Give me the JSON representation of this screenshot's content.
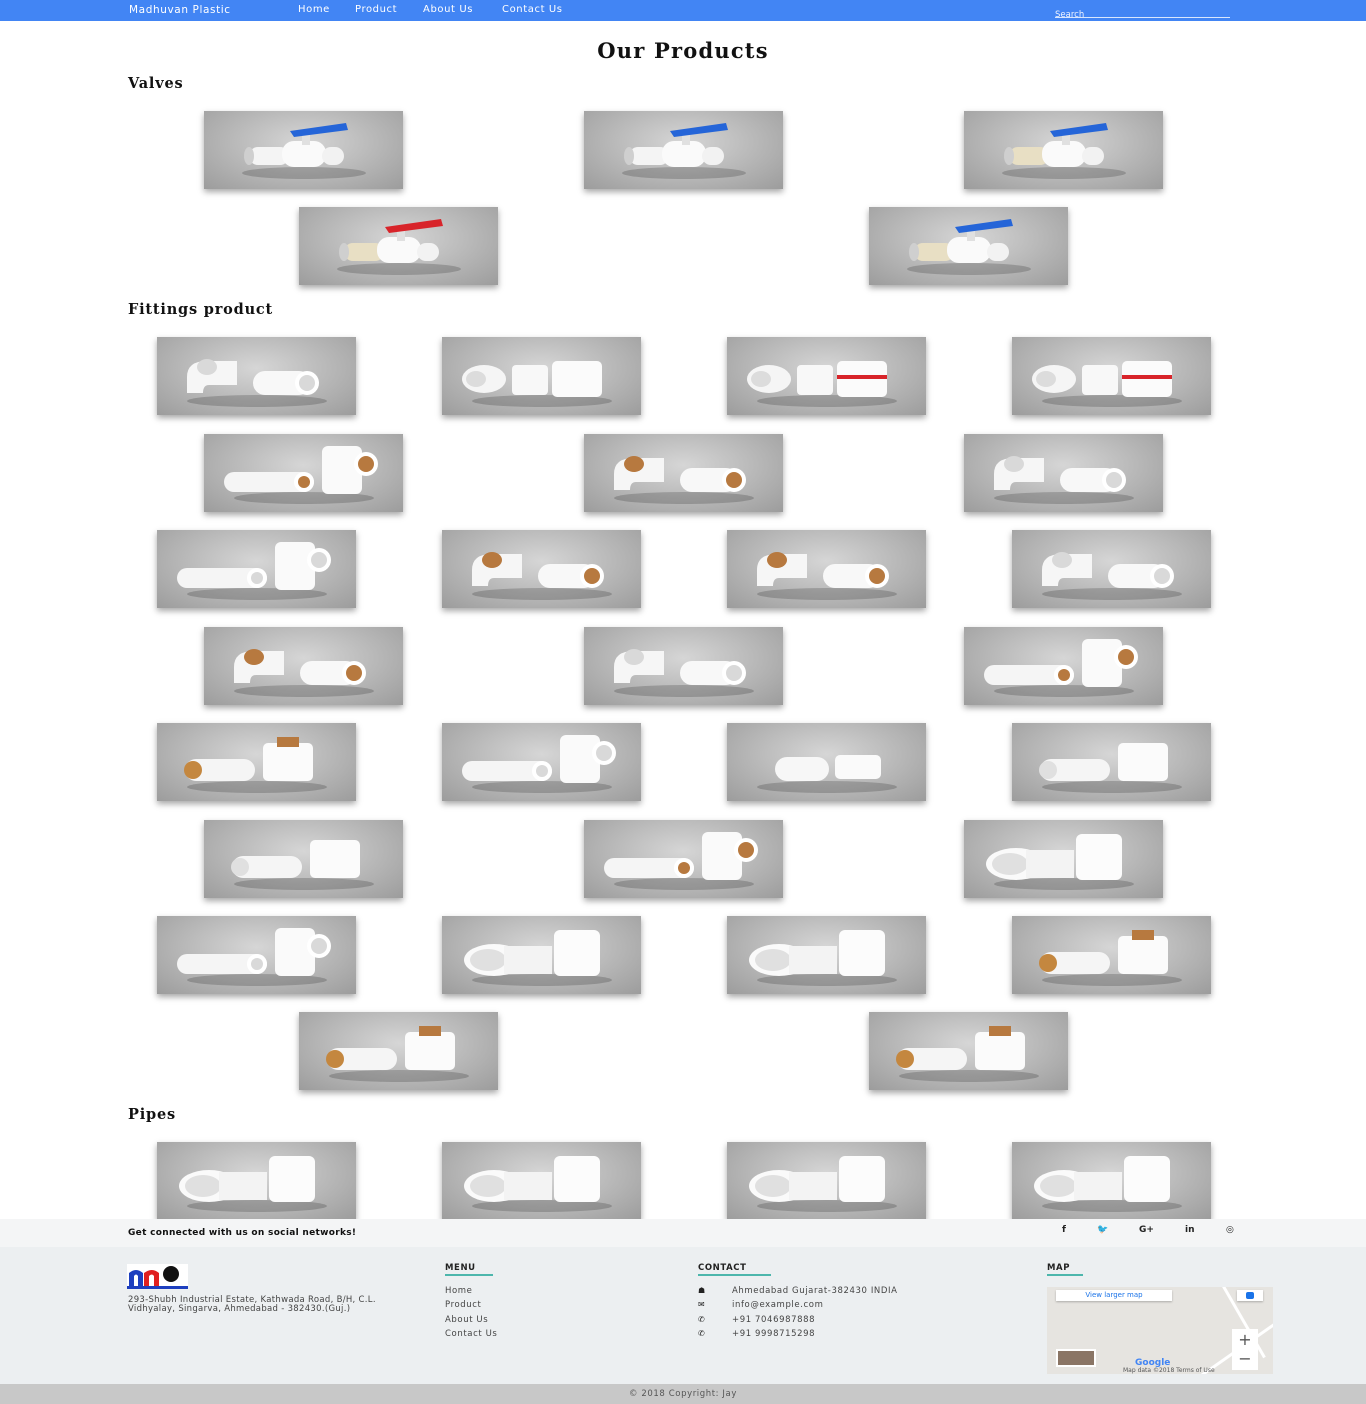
{
  "navbar": {
    "brand": "Madhuvan Plastic",
    "links": [
      "Home",
      "Product",
      "About Us",
      "Contact Us"
    ],
    "search_placeholder": "Search",
    "background_color": "#4285f4"
  },
  "page_title": "Our Products",
  "sections": [
    {
      "title": "Valves",
      "products": [
        {
          "icon": "blue-handle-ball-valve"
        },
        {
          "icon": "blue-handle-ball-valve"
        },
        {
          "icon": "blue-handle-cpvc-ball-valve"
        },
        {
          "icon": "red-handle-cpvc-ball-valve"
        },
        {
          "icon": "blue-handle-cpvc-ball-valve"
        }
      ]
    },
    {
      "title": "Fittings product",
      "products": [
        {
          "icon": "elbow-fitting"
        },
        {
          "icon": "union-fitting"
        },
        {
          "icon": "union-fitting-red-ring"
        },
        {
          "icon": "union-fitting-red-ring"
        },
        {
          "icon": "brass-tee-fitting"
        },
        {
          "icon": "brass-socket-fitting"
        },
        {
          "icon": "elbow-fitting"
        },
        {
          "icon": "tee-fitting"
        },
        {
          "icon": "brass-elbow-fitting"
        },
        {
          "icon": "brass-elbow-fitting"
        },
        {
          "icon": "elbow-fitting"
        },
        {
          "icon": "brass-elbow-fitting"
        },
        {
          "icon": "elbow-fitting"
        },
        {
          "icon": "brass-tee-fitting"
        },
        {
          "icon": "brass-male-adapter"
        },
        {
          "icon": "tee-fitting"
        },
        {
          "icon": "end-cap-fitting"
        },
        {
          "icon": "female-adapter"
        },
        {
          "icon": "male-adapter"
        },
        {
          "icon": "brass-tee-fitting"
        },
        {
          "icon": "brass-reducer-fitting"
        },
        {
          "icon": "tee-fitting"
        },
        {
          "icon": "coupler-fitting"
        },
        {
          "icon": "reducer-fitting"
        },
        {
          "icon": "brass-threaded-adapter"
        },
        {
          "icon": "brass-female-adapter"
        },
        {
          "icon": "brass-male-adapter"
        }
      ]
    },
    {
      "title": "Pipes",
      "products": [
        {
          "icon": "pipe-socket"
        },
        {
          "icon": "pipe-socket"
        },
        {
          "icon": "pipe-socket"
        },
        {
          "icon": "pipe-socket"
        }
      ]
    }
  ],
  "social": {
    "text": "Get connected with us on social networks!",
    "icons": [
      "f",
      "🐦",
      "G+",
      "in",
      "◎"
    ],
    "icon_names": [
      "facebook-icon",
      "twitter-icon",
      "google-plus-icon",
      "linkedin-icon",
      "instagram-icon"
    ]
  },
  "footer": {
    "address": "293-Shubh Industrial Estate, Kathwada Road, B/H, C.L. Vidhyalay, Singarva, Ahmedabad - 382430.(Guj.)",
    "menu_heading": "MENU",
    "menu_links": [
      "Home",
      "Product",
      "About Us",
      "Contact Us"
    ],
    "contact_heading": "CONTACT",
    "contacts": [
      {
        "icon": "☗",
        "text": "Ahmedabad Gujarat-382430 INDIA"
      },
      {
        "icon": "✉",
        "text": "info@example.com"
      },
      {
        "icon": "✆",
        "text": "+91 7046987888"
      },
      {
        "icon": "✆",
        "text": "+91 9998715298"
      }
    ],
    "map_heading": "MAP",
    "map": {
      "view_larger": "View larger map",
      "google": "Google",
      "attribution": "Map data ©2018   Terms of Use",
      "zoom_in": "+",
      "zoom_out": "−"
    },
    "accent_color": "#4db6ac"
  },
  "copyright": "© 2018 Copyright: Jay"
}
